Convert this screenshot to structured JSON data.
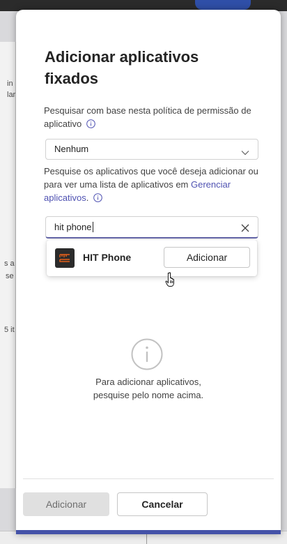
{
  "backdrop": {
    "fragments": [
      "in",
      "lar",
      "s a",
      "se",
      "5 it"
    ]
  },
  "panel": {
    "title": "Adicionar aplicativos fixados",
    "policy_label": "Pesquisar com base nesta política de permissão de aplicativo",
    "policy_select_value": "Nenhum",
    "description_prefix": "Pesquise os aplicativos que você deseja adicionar ou para ver uma lista de aplicativos em ",
    "manage_link": "Gerenciar aplicativos",
    "description_suffix": ".",
    "search_value": "hit phone",
    "result": {
      "app_name": "HIT Phone",
      "add_label": "Adicionar",
      "icon_color": "#e8611a"
    },
    "empty_state": {
      "line1": "Para adicionar aplicativos,",
      "line2": "pesquise pelo nome acima."
    },
    "footer": {
      "primary_label": "Adicionar",
      "cancel_label": "Cancelar"
    }
  },
  "colors": {
    "accent": "#6264a7",
    "link": "#4f52b2",
    "bottom_accent": "#4452a8"
  }
}
